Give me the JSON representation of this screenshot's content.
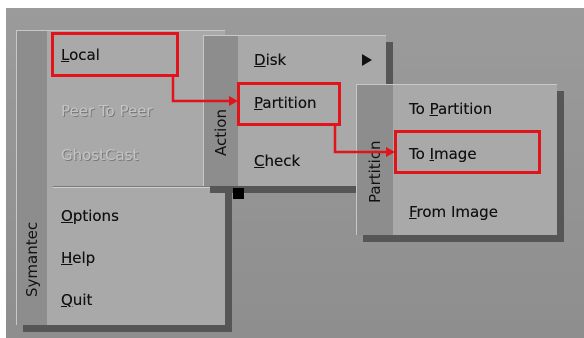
{
  "main_menu": {
    "brand": "Symantec",
    "items": [
      {
        "label_pre": "",
        "mnemonic": "L",
        "label_post": "ocal",
        "enabled": true
      },
      {
        "label_pre": "",
        "mnemonic": "",
        "label_post": "Peer To Peer",
        "enabled": false
      },
      {
        "label_pre": "",
        "mnemonic": "",
        "label_post": "GhostCast",
        "enabled": false
      },
      {
        "label_pre": "",
        "mnemonic": "O",
        "label_post": "ptions",
        "enabled": true
      },
      {
        "label_pre": "",
        "mnemonic": "H",
        "label_post": "elp",
        "enabled": true
      },
      {
        "label_pre": "",
        "mnemonic": "Q",
        "label_post": "uit",
        "enabled": true
      }
    ]
  },
  "action_menu": {
    "title": "Action",
    "items": [
      {
        "label_pre": "",
        "mnemonic": "D",
        "label_post": "isk",
        "submenu_icon": "triangle-right-icon"
      },
      {
        "label_pre": "",
        "mnemonic": "P",
        "label_post": "artition",
        "submenu_icon": ""
      },
      {
        "label_pre": "",
        "mnemonic": "C",
        "label_post": "heck",
        "submenu_icon": ""
      }
    ]
  },
  "partition_menu": {
    "title": "Partition",
    "items": [
      {
        "label_pre": "To ",
        "mnemonic": "P",
        "label_post": "artition"
      },
      {
        "label_pre": "To ",
        "mnemonic": "I",
        "label_post": "mage"
      },
      {
        "label_pre": "",
        "mnemonic": "F",
        "label_post": "rom Image"
      }
    ]
  },
  "highlight_color": "#e1141c",
  "path_highlighted": [
    "Local",
    "Partition",
    "To Image"
  ]
}
